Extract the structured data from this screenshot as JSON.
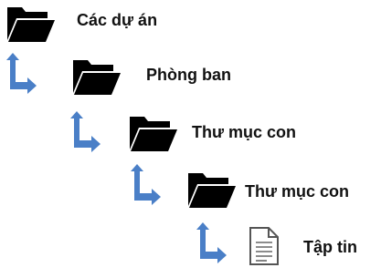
{
  "tree": {
    "items": [
      {
        "label": "Các dự án",
        "type": "folder",
        "level": 0
      },
      {
        "label": "Phòng ban",
        "type": "folder",
        "level": 1
      },
      {
        "label": "Thư mục con",
        "type": "folder",
        "level": 2
      },
      {
        "label": "Thư mục con",
        "type": "folder",
        "level": 3
      },
      {
        "label": "Tập tin",
        "type": "file",
        "level": 4
      }
    ]
  },
  "icons": {
    "folder": "folder-icon",
    "arrow": "turn-right-arrow-icon",
    "file": "document-icon"
  },
  "colors": {
    "folder": "#000000",
    "arrow": "#4A7FC7",
    "file_outline": "#555555",
    "text": "#111111"
  }
}
